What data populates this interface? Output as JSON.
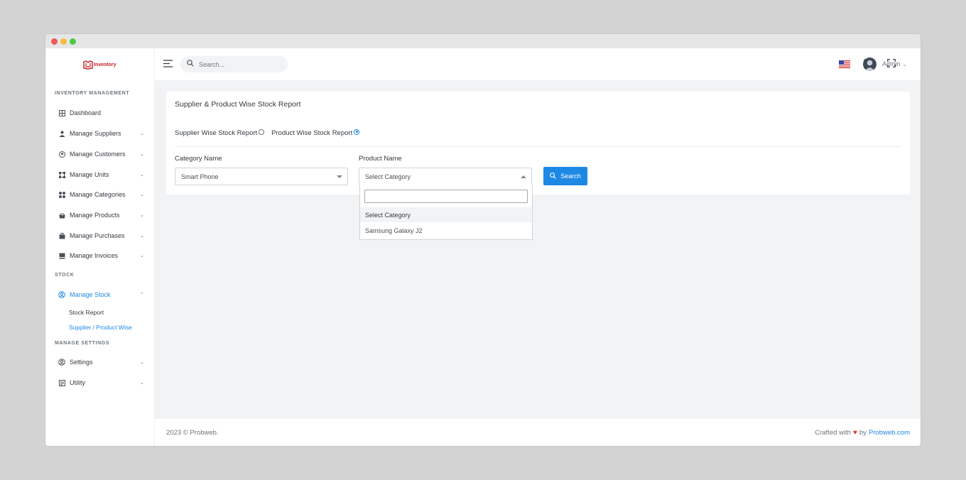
{
  "brand": {
    "name": "Inventory"
  },
  "header": {
    "search_placeholder": "Search...",
    "user_name": "Admin"
  },
  "sidebar": {
    "section_inventory": "INVENTORY MANAGEMENT",
    "section_stock": "STOCK",
    "section_settings": "MANAGE SETTINGS",
    "items": [
      {
        "label": "Dashboard",
        "icon": "dashboard-icon"
      },
      {
        "label": "Manage Suppliers",
        "icon": "user-icon"
      },
      {
        "label": "Manage Customers",
        "icon": "location-pin-icon"
      },
      {
        "label": "Manage Units",
        "icon": "units-icon"
      },
      {
        "label": "Manage Categories",
        "icon": "categories-icon"
      },
      {
        "label": "Manage Products",
        "icon": "products-icon"
      },
      {
        "label": "Manage Purchases",
        "icon": "briefcase-icon"
      },
      {
        "label": "Manage Invoices",
        "icon": "invoice-icon"
      }
    ],
    "stock_item": {
      "label": "Manage Stock",
      "icon": "stock-icon"
    },
    "stock_subitems": [
      {
        "label": "Stock Report"
      },
      {
        "label": "Supplier / Product Wise"
      }
    ],
    "settings_items": [
      {
        "label": "Settings",
        "icon": "settings-icon"
      },
      {
        "label": "Utility",
        "icon": "utility-icon"
      }
    ]
  },
  "card": {
    "title": "Supplier & Product Wise Stock Report",
    "radio_supplier": "Supplier Wise Stock Report",
    "radio_product": "Product Wise Stock Report",
    "radio_selected": "product",
    "category_label": "Category Name",
    "category_value": "Smart Phone",
    "product_label": "Product Name",
    "product_value": "Select Category",
    "search_button": "Search"
  },
  "dropdown": {
    "search_value": "",
    "options": [
      "Select Category",
      "Samsung Galaxy J2"
    ],
    "selected": "Select Category"
  },
  "footer": {
    "copyright": "2023 © Probweb.",
    "crafted": "Crafted with",
    "by": "by",
    "link": "Probweb.com"
  },
  "colors": {
    "accent": "#1e88e5",
    "brand_red": "#c41f22",
    "heart": "#e53935"
  }
}
